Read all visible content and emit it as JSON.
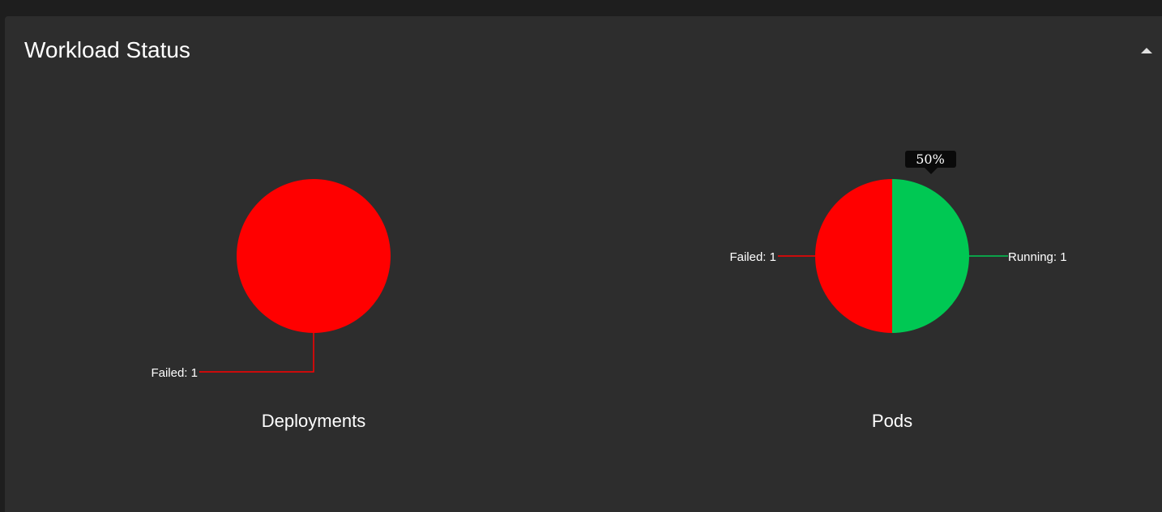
{
  "panel": {
    "title": "Workload Status"
  },
  "colors": {
    "failed": "#ff0000",
    "running": "#00c853",
    "panel_bg": "#2d2d2d",
    "tooltip_bg": "#0a0a0a"
  },
  "icons": {
    "collapse": "caret-up-icon"
  },
  "chart_data": [
    {
      "type": "pie",
      "title": "Deployments",
      "slices": [
        {
          "label": "Failed",
          "value": 1,
          "color": "#ff0000",
          "display": "Failed: 1"
        }
      ]
    },
    {
      "type": "pie",
      "title": "Pods",
      "slices": [
        {
          "label": "Failed",
          "value": 1,
          "color": "#ff0000",
          "display": "Failed: 1"
        },
        {
          "label": "Running",
          "value": 1,
          "color": "#00c853",
          "display": "Running: 1"
        }
      ],
      "tooltip": "50%"
    }
  ]
}
